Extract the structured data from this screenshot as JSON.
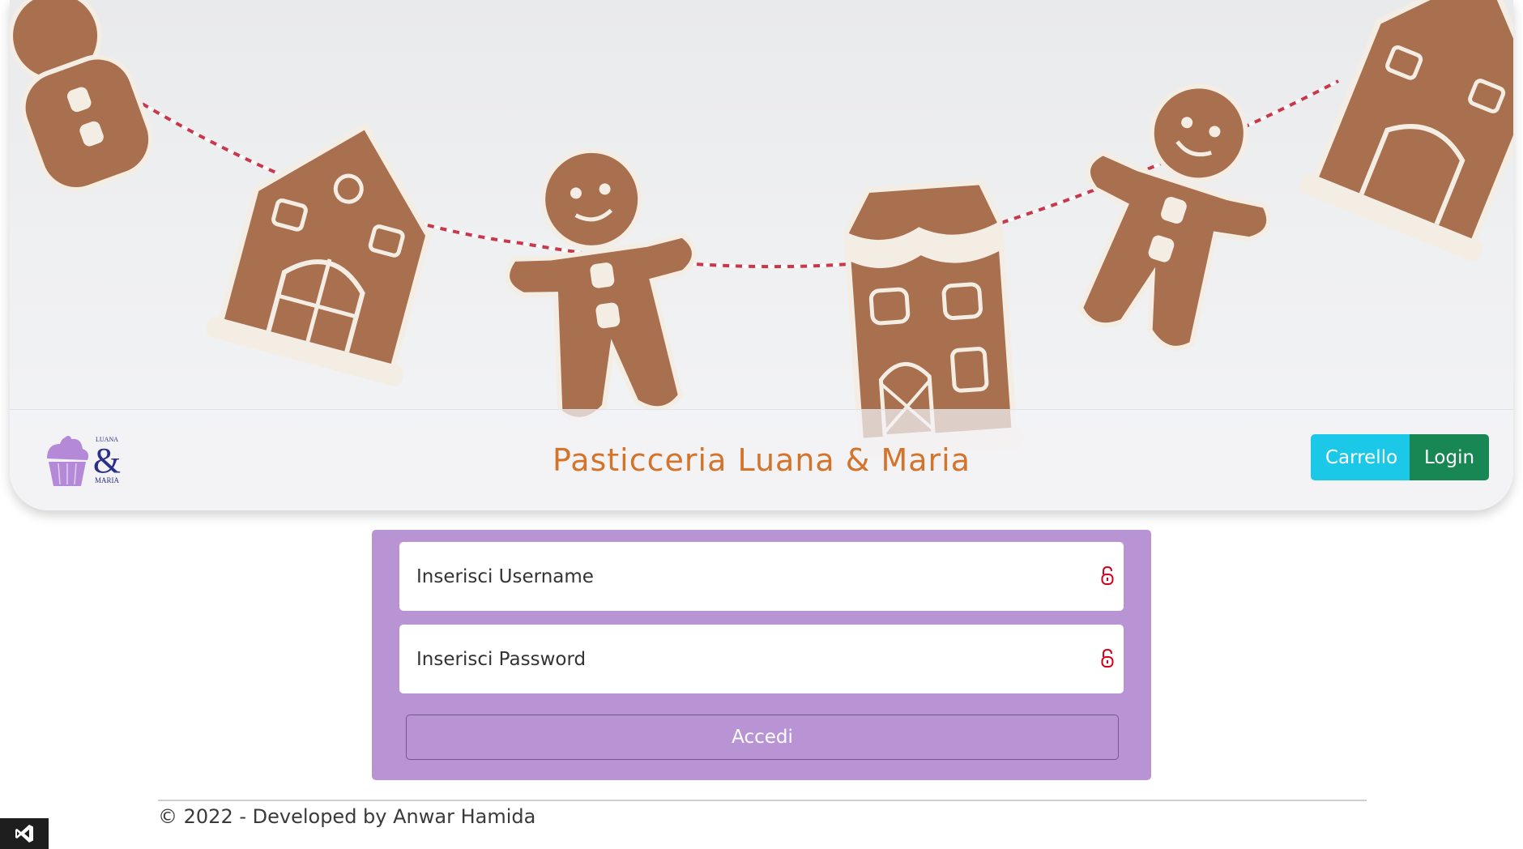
{
  "header": {
    "title": "Pasticceria Luana & Maria",
    "logo": {
      "icon": "cupcake-icon",
      "text_top": "LUANA",
      "text_amp": "&",
      "text_bottom": "MARIA"
    },
    "cart_label": "Carrello",
    "login_label": "Login"
  },
  "hero": {
    "image": "gingerbread-garland-banner"
  },
  "login_form": {
    "username_placeholder": "Inserisci Username",
    "password_placeholder": "Inserisci Password",
    "field_icon": "lock-icon",
    "submit_label": "Accedi"
  },
  "footer": {
    "text": "© 2022 - Developed by Anwar Hamida"
  },
  "taskbar": {
    "icon": "visual-studio-icon"
  },
  "colors": {
    "title": "#d4732a",
    "cart_button": "#1cc8e8",
    "login_button": "#198754",
    "form_background": "#b894d5",
    "lock_icon": "#d0021b"
  }
}
